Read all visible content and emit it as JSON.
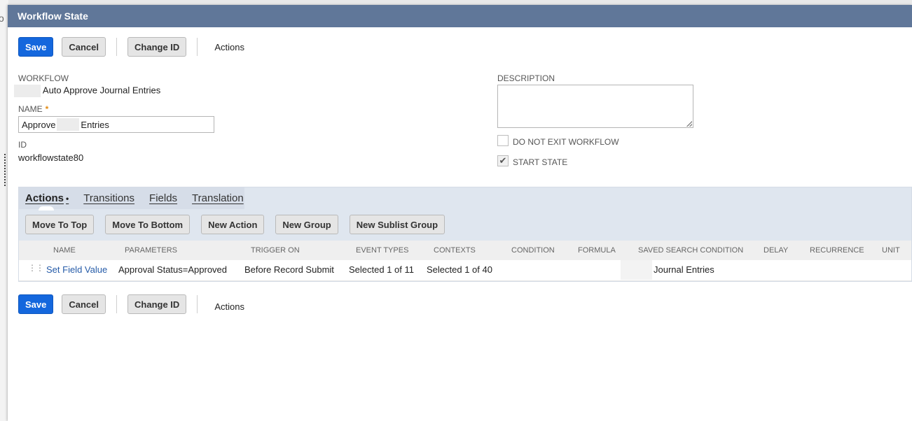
{
  "background": {
    "glyph": "o"
  },
  "dialog": {
    "title": "Workflow State"
  },
  "toolbar": {
    "save_label": "Save",
    "cancel_label": "Cancel",
    "change_id_label": "Change ID",
    "actions_label": "Actions"
  },
  "form": {
    "workflow_label": "WORKFLOW",
    "workflow_value": "Auto Approve Journal Entries",
    "name_label": "NAME",
    "required_mark": "*",
    "name_value_prefix": "Approve",
    "name_value_suffix": "Entries",
    "id_label": "ID",
    "id_value": "workflowstate80",
    "description_label": "DESCRIPTION",
    "do_not_exit_label": "DO NOT EXIT WORKFLOW",
    "do_not_exit_checked": false,
    "start_state_label": "START STATE",
    "start_state_checked": true,
    "check_mark": "✔"
  },
  "sublist": {
    "tabs": [
      {
        "label": "Actions",
        "active": true,
        "dot": "•"
      },
      {
        "label": "Transitions"
      },
      {
        "label": "Fields"
      },
      {
        "label": "Translation"
      }
    ],
    "buttons": {
      "move_to_top": "Move To Top",
      "move_to_bottom": "Move To Bottom",
      "new_action": "New Action",
      "new_group": "New Group",
      "new_sublist_group": "New Sublist Group"
    },
    "columns": {
      "name": "NAME",
      "parameters": "PARAMETERS",
      "trigger_on": "TRIGGER ON",
      "event_types": "EVENT TYPES",
      "contexts": "CONTEXTS",
      "condition": "CONDITION",
      "formula": "FORMULA",
      "saved_search_condition": "SAVED SEARCH CONDITION",
      "delay": "DELAY",
      "recurrence": "RECURRENCE",
      "unit": "UNIT"
    },
    "rows": [
      {
        "handle": "⋮⋮",
        "name": "Set Field Value",
        "parameters": "Approval Status=Approved",
        "trigger_on": "Before Record Submit",
        "event_types": "Selected 1 of 11",
        "contexts": "Selected 1 of 40",
        "saved_search_condition": "Journal Entries"
      }
    ]
  },
  "colors": {
    "titlebar": "#607799",
    "primary_button": "#1467dd",
    "link": "#255ba8",
    "required": "#e38b12"
  }
}
